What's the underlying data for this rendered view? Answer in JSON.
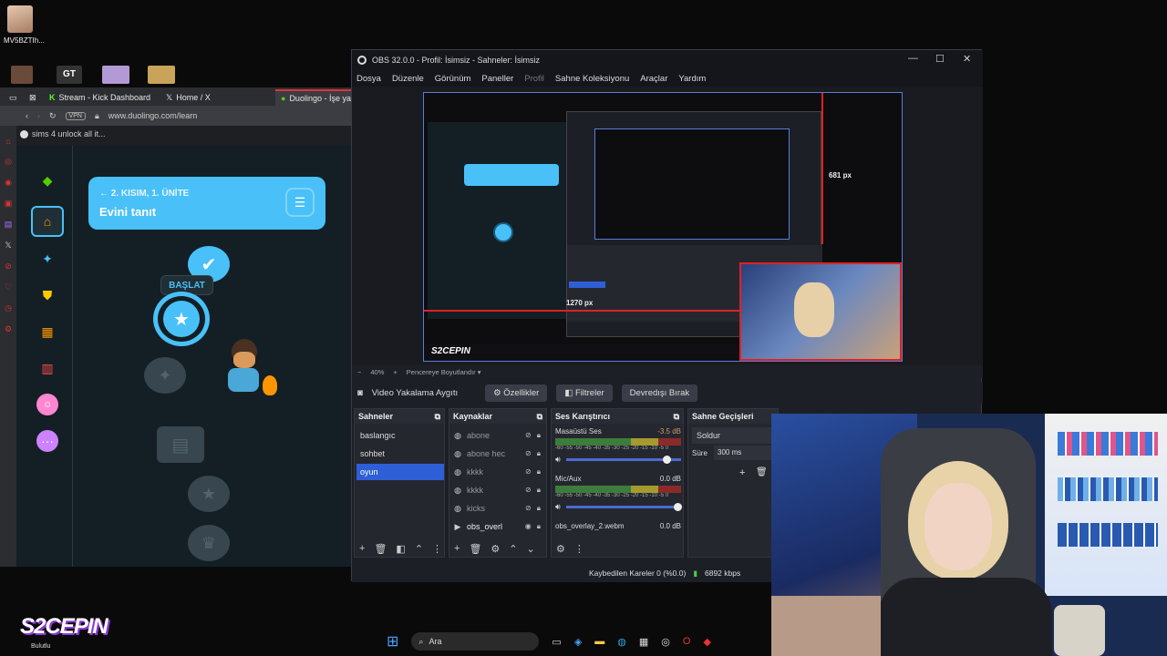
{
  "desktop": {
    "profile_name": "MV5BZTIh...",
    "watermark": "S2CEPIN",
    "weather_label": "Bulutlu"
  },
  "browser": {
    "tabs": [
      {
        "label": "Stream - Kick Dashboard",
        "icon": "kick-icon"
      },
      {
        "label": "Home / X",
        "icon": "x-icon"
      },
      {
        "label": "Duolingo - İşe ya",
        "icon": "duolingo-icon"
      }
    ],
    "vpn_label": "VPN",
    "url": "www.duolingo.com/learn",
    "notification": "sims 4 unlock all it...",
    "accent": "#d33a3a"
  },
  "duolingo": {
    "unit_subtitle": "2. KISIM, 1. ÜNİTE",
    "unit_title": "Evini tanıt",
    "start_label": "BAŞLAT",
    "nav_icons": [
      "learn-icon",
      "home-icon",
      "practice-icon",
      "shield-icon",
      "chest-icon",
      "quests-icon",
      "profile-icon",
      "more-icon"
    ],
    "accent": "#49c0f8"
  },
  "obs": {
    "title": "OBS 32.0.0 - Profil: İsimsiz - Sahneler: İsimsiz",
    "menu": [
      "Dosya",
      "Düzenle",
      "Görünüm",
      "Paneller",
      "Profil",
      "Sahne Koleksiyonu",
      "Araçlar",
      "Yardım"
    ],
    "preview": {
      "height_label": "681 px",
      "width_label": "1270 px",
      "zoom": "40%",
      "fit_label": "Pencereye Boyutlandır"
    },
    "source_bar": {
      "source_name": "Video Yakalama Aygıtı",
      "properties": "Özellikler",
      "filters": "Filtreler",
      "deactivate": "Devredışı Bırak"
    },
    "scenes": {
      "header": "Sahneler",
      "items": [
        "baslangıc",
        "sohbet",
        "oyun"
      ],
      "selected": "oyun"
    },
    "sources": {
      "header": "Kaynaklar",
      "items": [
        {
          "name": "abone",
          "icon": "globe-icon",
          "visible": false,
          "locked": true
        },
        {
          "name": "abone hec",
          "icon": "globe-icon",
          "visible": false,
          "locked": true
        },
        {
          "name": "kkkk",
          "icon": "globe-icon",
          "visible": false,
          "locked": true
        },
        {
          "name": "kkkk",
          "icon": "globe-icon",
          "visible": false,
          "locked": true
        },
        {
          "name": "kicks",
          "icon": "globe-icon",
          "visible": false,
          "locked": true
        },
        {
          "name": "obs_overl",
          "icon": "play-icon",
          "visible": true,
          "locked": true
        }
      ]
    },
    "mixer": {
      "header": "Ses Karıştırıcı",
      "scale": "-60 -55 -50 -45 -40 -35 -30 -25 -20 -15 -10 -5 0",
      "channels": [
        {
          "name": "Masaüstü Ses",
          "db": "-3.5 dB",
          "level": 0.9
        },
        {
          "name": "Mic/Aux",
          "db": "0.0 dB",
          "level": 1.0
        },
        {
          "name": "obs_overlay_2.webm",
          "db": "0.0 dB",
          "level": 1.0
        }
      ]
    },
    "transitions": {
      "header": "Sahne Geçişleri",
      "type": "Soldur",
      "duration_label": "Süre",
      "duration": "300 ms"
    },
    "status": {
      "dropped": "Kaybedilen Kareler 0 (%0.0)",
      "bitrate": "6892 kbps"
    }
  },
  "taskbar": {
    "search_placeholder": "Ara"
  }
}
